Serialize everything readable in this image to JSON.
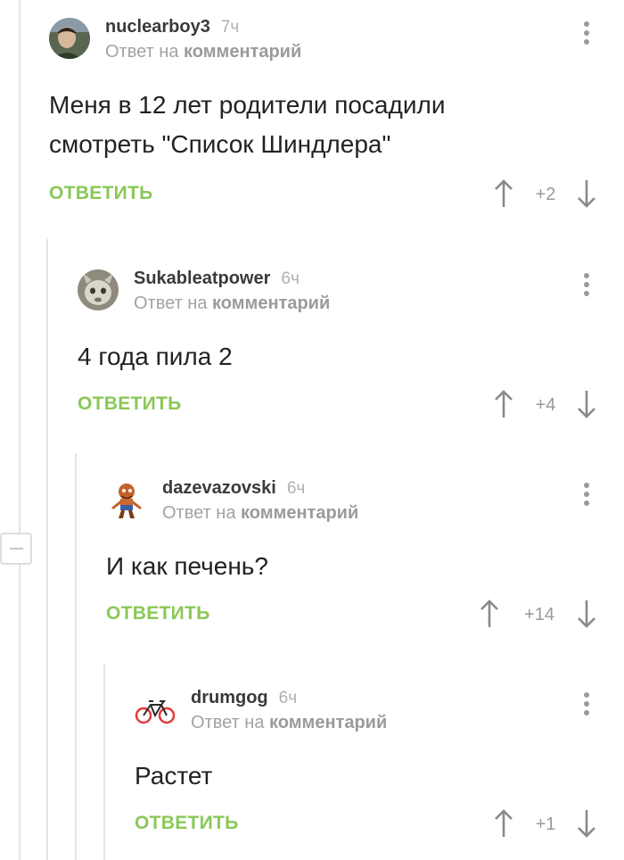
{
  "comments": [
    {
      "username": "nuclearboy3",
      "time": "7ч",
      "reply_prefix": "Ответ на",
      "reply_target": "комментарий",
      "text_lines": [
        "Меня в 12 лет родители посадили",
        "смотреть \"Список Шиндлера\""
      ],
      "reply_label": "ОТВЕТИТЬ",
      "rating": "+2"
    },
    {
      "username": "Sukableatpower",
      "time": "6ч",
      "reply_prefix": "Ответ на",
      "reply_target": "комментарий",
      "text_lines": [
        "4 года пила 2"
      ],
      "reply_label": "ОТВЕТИТЬ",
      "rating": "+4"
    },
    {
      "username": "dazevazovski",
      "time": "6ч",
      "reply_prefix": "Ответ на",
      "reply_target": "комментарий",
      "text_lines": [
        "И как печень?"
      ],
      "reply_label": "ОТВЕТИТЬ",
      "rating": "+14"
    },
    {
      "username": "drumgog",
      "time": "6ч",
      "reply_prefix": "Ответ на",
      "reply_target": "комментарий",
      "text_lines": [
        "Растет"
      ],
      "reply_label": "ОТВЕТИТЬ",
      "rating": "+1"
    }
  ],
  "colors": {
    "reply_green": "#8ac858",
    "thread_line": "#e4e4e4",
    "muted_text": "#a3a3a3"
  },
  "icons": [
    "menu-dots-icon",
    "arrow-up-icon",
    "arrow-down-icon",
    "collapse-minus-icon"
  ]
}
